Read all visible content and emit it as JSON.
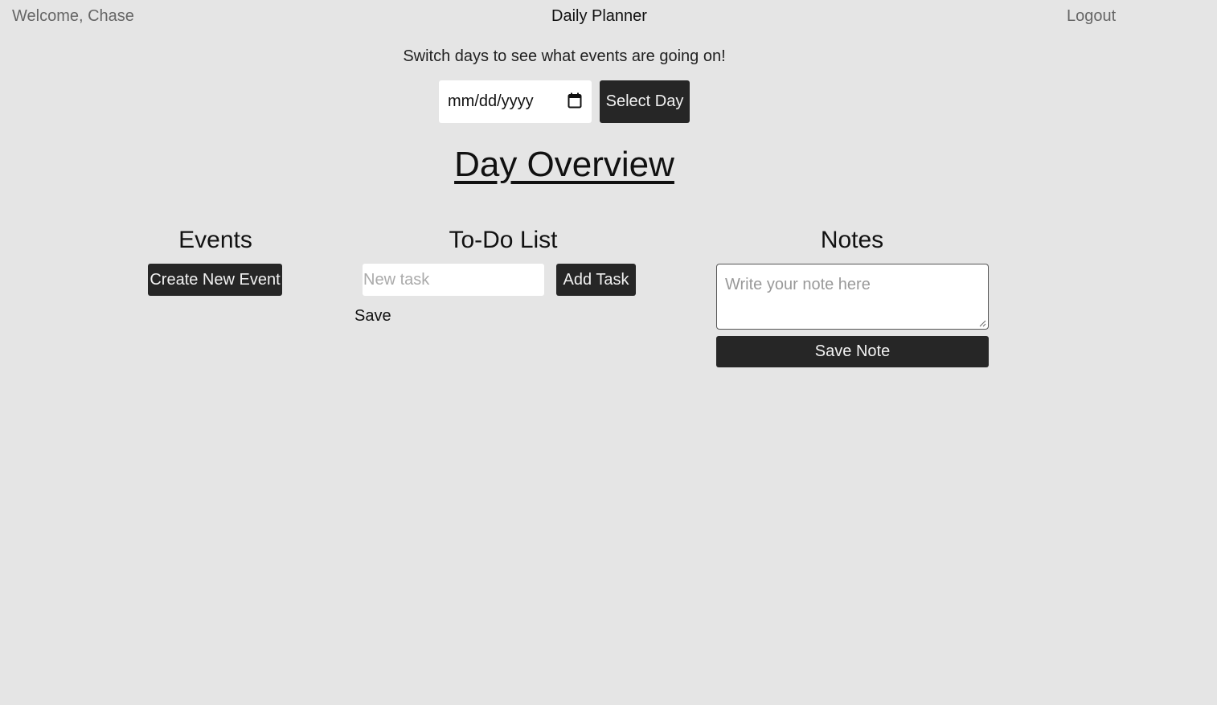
{
  "header": {
    "welcome": "Welcome, Chase",
    "app_title": "Daily Planner",
    "logout_label": "Logout"
  },
  "day_picker": {
    "prompt": "Switch days to see what events are going on!",
    "date_placeholder": "mm/dd/yyyy",
    "select_label": "Select Day",
    "icon": "calendar-icon"
  },
  "overview_title": "Day Overview",
  "events": {
    "title": "Events",
    "create_label": "Create New Event"
  },
  "todo": {
    "title": "To-Do List",
    "input_placeholder": "New task",
    "add_label": "Add Task",
    "save_label": "Save"
  },
  "notes": {
    "title": "Notes",
    "textarea_placeholder": "Write your note here",
    "save_label": "Save Note"
  },
  "colors": {
    "background": "#e5e5e5",
    "button_dark": "#262626",
    "button_text": "#f2f2f2",
    "muted_text": "#666666"
  }
}
